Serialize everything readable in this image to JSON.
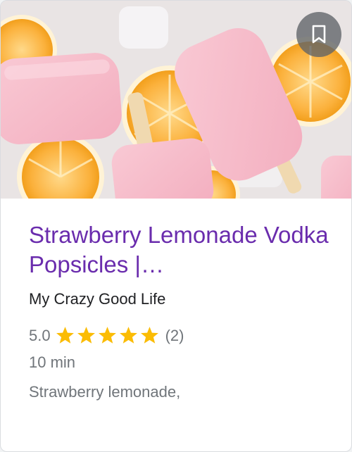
{
  "card": {
    "image_alt": "strawberry-lemonade-popsicles-photo",
    "bookmark_icon": "bookmark-icon",
    "title": "Strawberry Lemonade Vodka Popsicles |…",
    "source": "My Crazy Good Life",
    "rating": {
      "score_text": "5.0",
      "stars_filled": 5,
      "stars_total": 5,
      "count_text": "(2)"
    },
    "time": "10 min",
    "snippet": "Strawberry lemonade,"
  },
  "colors": {
    "title": "#6a2cad",
    "star": "#fbbc04",
    "muted": "#70757a",
    "bookmark_bg": "#5f6368"
  }
}
